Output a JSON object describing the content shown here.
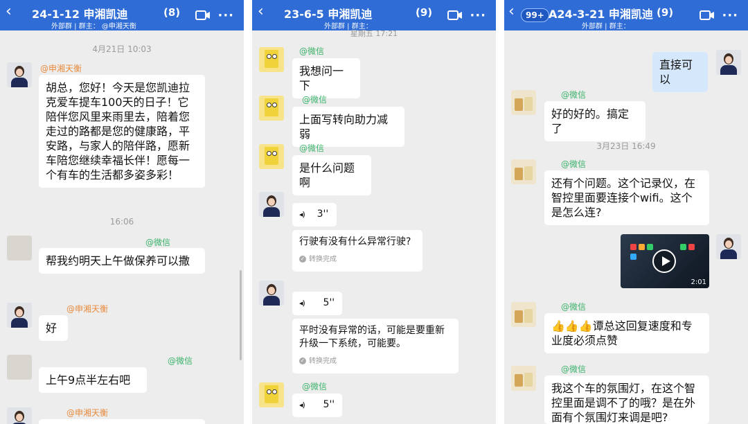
{
  "panels": [
    {
      "title": "24-1-12 申湘凯迪",
      "count": "(8)",
      "subtitle": "外部群 | 群主：  @申湘天衡",
      "messages": {
        "ts1": "4月21日 10:03",
        "m1_org": "@申湘天衡",
        "m1_text": "胡总，您好！今天是您凯迪拉克爱车提车100天的日子！它陪伴您风里来雨里去，陪着您走过的路都是您的健康路，平安路，与家人的陪伴路，愿新车陪您继续幸福长伴！愿每一个有车的生活都多姿多彩！",
        "ts2": "16:06",
        "m2_wx": "@微信",
        "m2_text": "帮我约明天上午做保养可以撒",
        "m3_org": "@申湘天衡",
        "m3_text": "好",
        "m4_wx": "@微信",
        "m4_text": "上午9点半左右吧",
        "m5_org": "@申湘天衡"
      }
    },
    {
      "title": "23-6-5 申湘凯迪",
      "count": "(9)",
      "subtitle": "外部群 | 群主：",
      "messages": {
        "ts1": "星期五 17:21",
        "m1_wx": "@微信",
        "m1_text": "我想问一下",
        "m2_wx": "@微信",
        "m2_text": "上面写转向助力减弱",
        "m3_wx": "@微信",
        "m3_text": "是什么问题啊",
        "v1_len": "3''",
        "t1_text": "行驶有没有什么异常行驶?",
        "t1_status": "转换完成",
        "v2_len": "5''",
        "t2_text": "平时没有异常的话，可能是要重新升级一下系统，可能要。",
        "t2_status": "转换完成",
        "m6_wx": "@微信",
        "v3_len": "5''"
      }
    },
    {
      "badge": "99+",
      "title": "A24-3-21 申湘凯迪",
      "count": "(9)",
      "subtitle": "外部群 | 群主：",
      "messages": {
        "m0_text": "直接可以",
        "m1_wx": "@微信",
        "m1_text": "好的好的。搞定了",
        "ts1": "3月23日 16:49",
        "m2_wx": "@微信",
        "m2_text": "还有个问题。这个记录仪，在智控里面要连接个wifi。这个是怎么连?",
        "video_duration": "2:01",
        "m3_wx": "@微信",
        "m3_text": "👍👍👍谭总这回复速度和专业度必须点赞",
        "m4_wx": "@微信",
        "m4_text": "我这个车的氛围灯，在这个智控里面是调不了的哦？是在外面有个氛围灯来调是吧?"
      }
    }
  ],
  "icons": {
    "back": "back-chevron-icon",
    "video_call": "video-call-icon",
    "more": "more-icon",
    "voice": "voice-wave-icon",
    "play": "play-icon",
    "check": "check-icon"
  }
}
